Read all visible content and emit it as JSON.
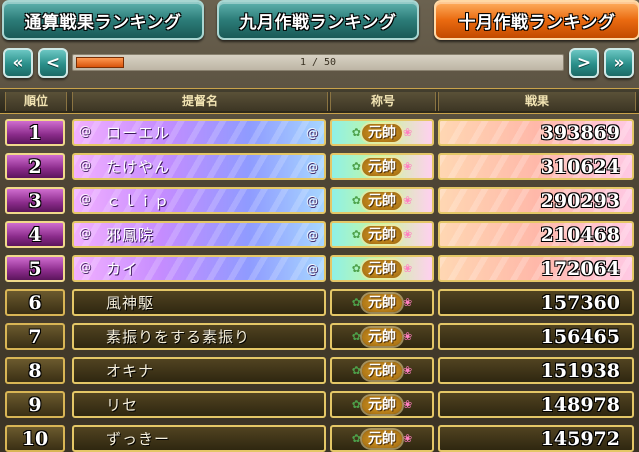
{
  "tabs": [
    {
      "label": "通算戦果ランキング",
      "color": "#2c7c78",
      "active": false
    },
    {
      "label": "九月作戦ランキング",
      "color": "#2c7c78",
      "active": false
    },
    {
      "label": "十月作戦ランキング",
      "color": "#ea6a10",
      "active": true
    }
  ],
  "pager": {
    "first_icon": "double-chevron-left-icon",
    "first_label": "«",
    "prev_icon": "chevron-left-icon",
    "prev_label": "<",
    "next_icon": "chevron-right-icon",
    "next_label": ">",
    "last_icon": "double-chevron-right-icon",
    "last_label": "»",
    "page_text": "1 / 50",
    "progress_fraction": 0.02
  },
  "columns": {
    "rank": "順位",
    "name": "提督名",
    "title": "称号",
    "score": "戦果"
  },
  "rows": [
    {
      "rank": "1",
      "name": "ローエル",
      "title": "元帥",
      "score": "393869",
      "highlight": true
    },
    {
      "rank": "2",
      "name": "たけやん",
      "title": "元帥",
      "score": "310624",
      "highlight": true
    },
    {
      "rank": "3",
      "name": "ｃｌｉｐ",
      "title": "元帥",
      "score": "290293",
      "highlight": true
    },
    {
      "rank": "4",
      "name": "邪鳳院",
      "title": "元帥",
      "score": "210468",
      "highlight": true
    },
    {
      "rank": "5",
      "name": "カイ",
      "title": "元帥",
      "score": "172064",
      "highlight": true
    },
    {
      "rank": "6",
      "name": "風神駆",
      "title": "元帥",
      "score": "157360",
      "highlight": false
    },
    {
      "rank": "7",
      "name": "素振りをする素振り",
      "title": "元帥",
      "score": "156465",
      "highlight": false
    },
    {
      "rank": "8",
      "name": "オキナ",
      "title": "元帥",
      "score": "151938",
      "highlight": false
    },
    {
      "rank": "9",
      "name": "リセ",
      "title": "元帥",
      "score": "148978",
      "highlight": false
    },
    {
      "rank": "10",
      "name": "ずっきー",
      "title": "元帥",
      "score": "145972",
      "highlight": false
    }
  ]
}
